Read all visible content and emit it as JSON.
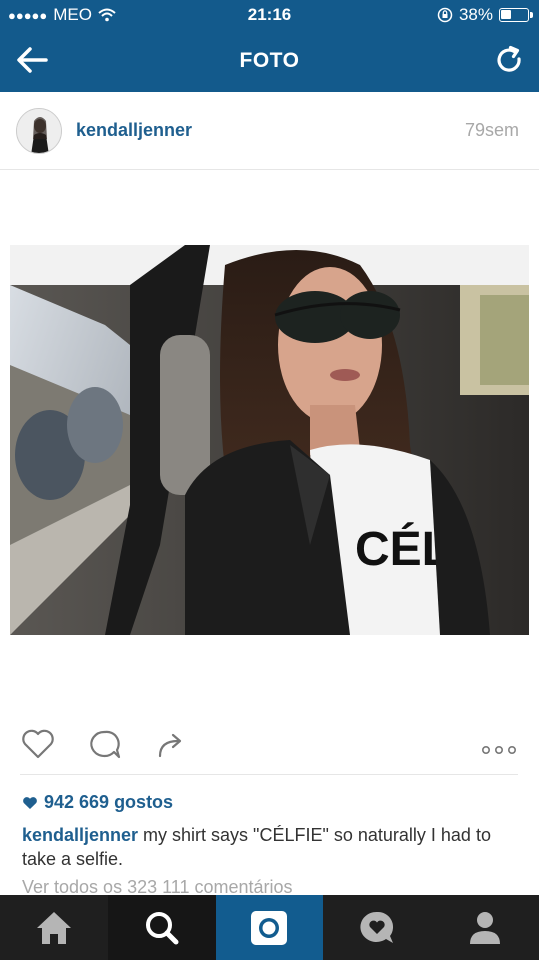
{
  "status_bar": {
    "carrier": "MEO",
    "time": "21:16",
    "battery_percent": "38%",
    "battery_level": 0.38
  },
  "nav": {
    "title": "FOTO",
    "back_icon": "arrow-left-icon",
    "refresh_icon": "refresh-icon"
  },
  "post": {
    "username": "kendalljenner",
    "time_ago": "79sem",
    "likes": "942 669 gostos",
    "caption_user": "kendalljenner",
    "caption_text": " my shirt says \"CÉLFIE\" so naturally I had to take a selfie.",
    "view_comments": "Ver todos os 323 111 comentários"
  },
  "colors": {
    "header_blue": "#135a8c",
    "link_blue": "#1f5f8f",
    "tabbar_dark": "#1f1f1f",
    "tab_active": "#125c8f"
  },
  "tabs": [
    {
      "icon": "home-icon"
    },
    {
      "icon": "search-icon"
    },
    {
      "icon": "camera-icon"
    },
    {
      "icon": "activity-icon"
    },
    {
      "icon": "profile-icon"
    }
  ]
}
